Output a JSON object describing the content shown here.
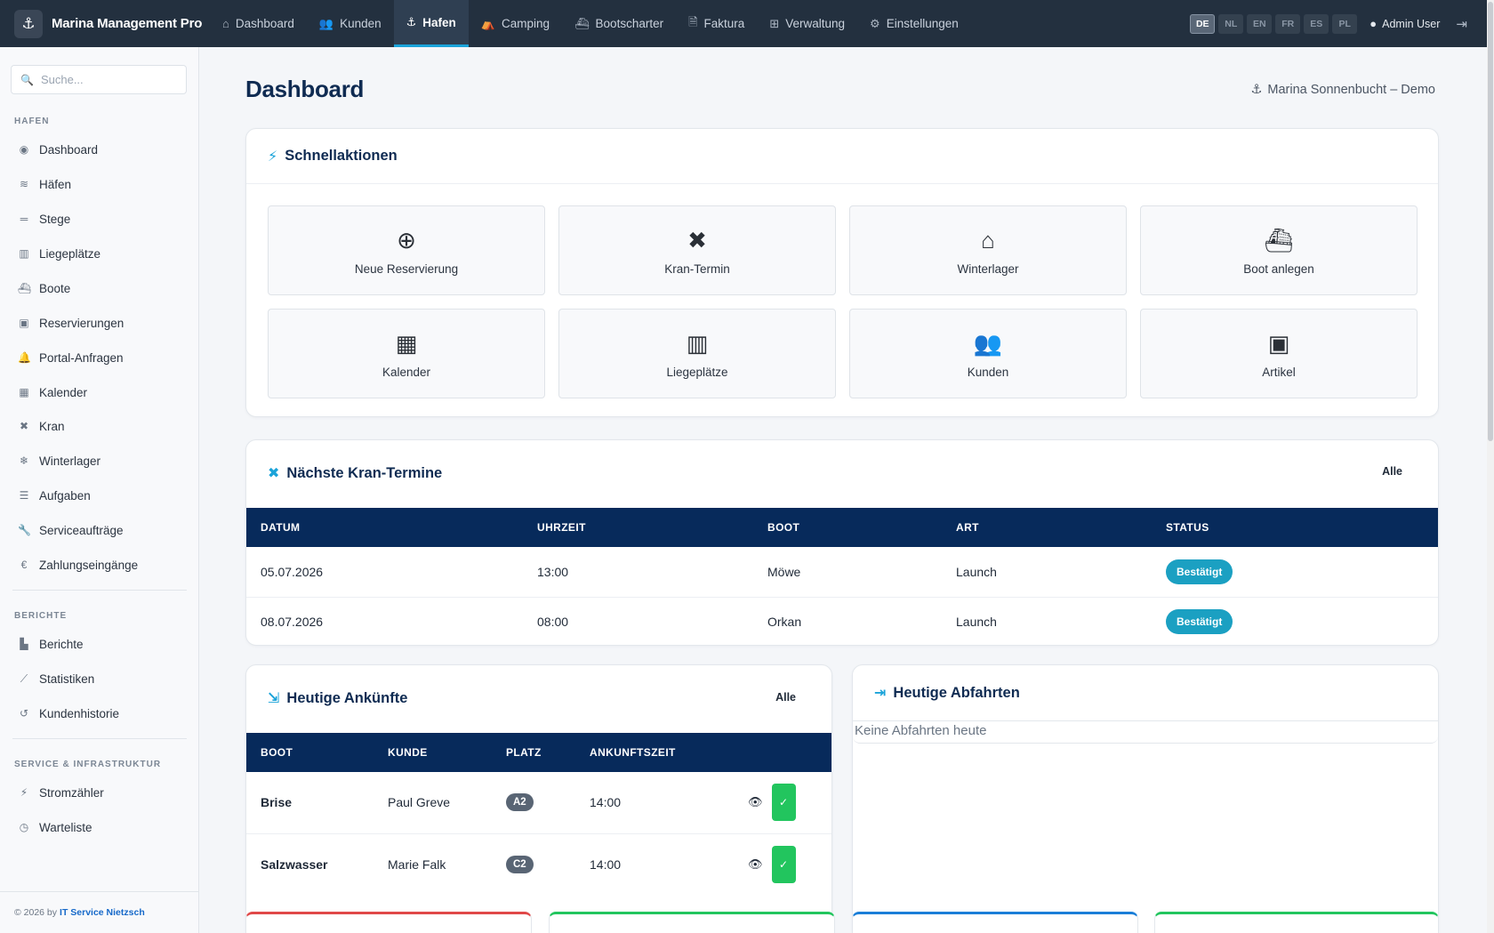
{
  "app": {
    "name": "Marina Management Pro",
    "logo_icon": "anchor-icon"
  },
  "nav": {
    "items": [
      {
        "label": "Dashboard",
        "icon": "home-icon",
        "glyph": "⌂"
      },
      {
        "label": "Kunden",
        "icon": "users-icon",
        "glyph": "👥"
      },
      {
        "label": "Hafen",
        "icon": "anchor-icon",
        "glyph": "⚓"
      },
      {
        "label": "Camping",
        "icon": "tent-icon",
        "glyph": "⛺"
      },
      {
        "label": "Bootscharter",
        "icon": "ship-icon",
        "glyph": "⛴"
      },
      {
        "label": "Faktura",
        "icon": "file-icon",
        "glyph": "🗎"
      },
      {
        "label": "Verwaltung",
        "icon": "table-icon",
        "glyph": "⊞"
      },
      {
        "label": "Einstellungen",
        "icon": "gear-icon",
        "glyph": "⚙"
      }
    ],
    "languages": [
      "DE",
      "NL",
      "EN",
      "FR",
      "ES",
      "PL"
    ],
    "active_language": "DE",
    "user": "Admin User"
  },
  "sidebar": {
    "search_placeholder": "Suche...",
    "sections": [
      {
        "label": "HAFEN"
      },
      {
        "label": "BERICHTE"
      },
      {
        "label": "SERVICE & INFRASTRUKTUR"
      }
    ],
    "items": [
      {
        "label": "Dashboard",
        "icon": "gauge-icon",
        "glyph": "◉"
      },
      {
        "label": "Häfen",
        "icon": "water-icon",
        "glyph": "≋"
      },
      {
        "label": "Stege",
        "icon": "dock-icon",
        "glyph": "═"
      },
      {
        "label": "Liegeplätze",
        "icon": "map-icon",
        "glyph": "▥"
      },
      {
        "label": "Boote",
        "icon": "ship-icon",
        "glyph": "⛴"
      },
      {
        "label": "Reservierungen",
        "icon": "calendar-check-icon",
        "glyph": "▣"
      },
      {
        "label": "Portal-Anfragen",
        "icon": "bell-icon",
        "glyph": "🔔"
      },
      {
        "label": "Kalender",
        "icon": "calendar-icon",
        "glyph": "▦"
      },
      {
        "label": "Kran",
        "icon": "tools-icon",
        "glyph": "✖"
      },
      {
        "label": "Winterlager",
        "icon": "snowflake-icon",
        "glyph": "❄"
      },
      {
        "label": "Aufgaben",
        "icon": "list-check-icon",
        "glyph": "☰"
      },
      {
        "label": "Serviceaufträge",
        "icon": "wrench-icon",
        "glyph": "🔧"
      },
      {
        "label": "Zahlungseingänge",
        "icon": "euro-icon",
        "glyph": "€"
      },
      {
        "label": "Berichte",
        "icon": "chart-bar-icon",
        "glyph": "▙"
      },
      {
        "label": "Statistiken",
        "icon": "chart-line-icon",
        "glyph": "⟋"
      },
      {
        "label": "Kundenhistorie",
        "icon": "history-icon",
        "glyph": "↺"
      },
      {
        "label": "Stromzähler",
        "icon": "bolt-icon",
        "glyph": "⚡"
      },
      {
        "label": "Warteliste",
        "icon": "clock-icon",
        "glyph": "◷"
      }
    ],
    "footer_prefix": "© 2026 by",
    "footer_link": "IT Service Nietzsch"
  },
  "main": {
    "title": "Dashboard",
    "marina": "Marina Sonnenbucht – Demo",
    "quick_actions": {
      "title": "Schnellaktionen",
      "items": [
        {
          "label": "Neue Reservierung",
          "icon": "plus-circle-icon",
          "glyph": "⊕"
        },
        {
          "label": "Kran-Termin",
          "icon": "tools-icon",
          "glyph": "✖"
        },
        {
          "label": "Winterlager",
          "icon": "warehouse-icon",
          "glyph": "⌂"
        },
        {
          "label": "Boot anlegen",
          "icon": "ship-icon",
          "glyph": "⛴"
        },
        {
          "label": "Kalender",
          "icon": "calendar-icon",
          "glyph": "▦"
        },
        {
          "label": "Liegeplätze",
          "icon": "map-icon",
          "glyph": "▥"
        },
        {
          "label": "Kunden",
          "icon": "users-icon",
          "glyph": "👥"
        },
        {
          "label": "Artikel",
          "icon": "box-icon",
          "glyph": "▣"
        }
      ]
    },
    "crane": {
      "title": "Nächste Kran-Termine",
      "all_link": "Alle",
      "columns": [
        "DATUM",
        "UHRZEIT",
        "BOOT",
        "ART",
        "STATUS"
      ],
      "rows": [
        {
          "date": "05.07.2026",
          "time": "13:00",
          "boat": "Möwe",
          "type": "Launch",
          "status": "Bestätigt"
        },
        {
          "date": "08.07.2026",
          "time": "08:00",
          "boat": "Orkan",
          "type": "Launch",
          "status": "Bestätigt"
        }
      ]
    },
    "arrivals": {
      "title": "Heutige Ankünfte",
      "all_link": "Alle",
      "columns": [
        "BOOT",
        "KUNDE",
        "PLATZ",
        "ANKUNFTSZEIT",
        ""
      ],
      "rows": [
        {
          "boat": "Brise",
          "customer": "Paul Greve",
          "place": "A2",
          "time": "14:00"
        },
        {
          "boat": "Salzwasser",
          "customer": "Marie Falk",
          "place": "C2",
          "time": "14:00"
        }
      ]
    },
    "departures": {
      "title": "Heutige Abfahrten",
      "empty": "Keine Abfahrten heute"
    }
  },
  "colors": {
    "nav_bg": "#23303f",
    "accent": "#1aa3d9",
    "table_header": "#072a5b",
    "badge": "#1ba0c2",
    "success": "#22c55e",
    "stat_colors": [
      "#e04848",
      "#22c55e",
      "#1a7ed8",
      "#22c55e"
    ]
  }
}
